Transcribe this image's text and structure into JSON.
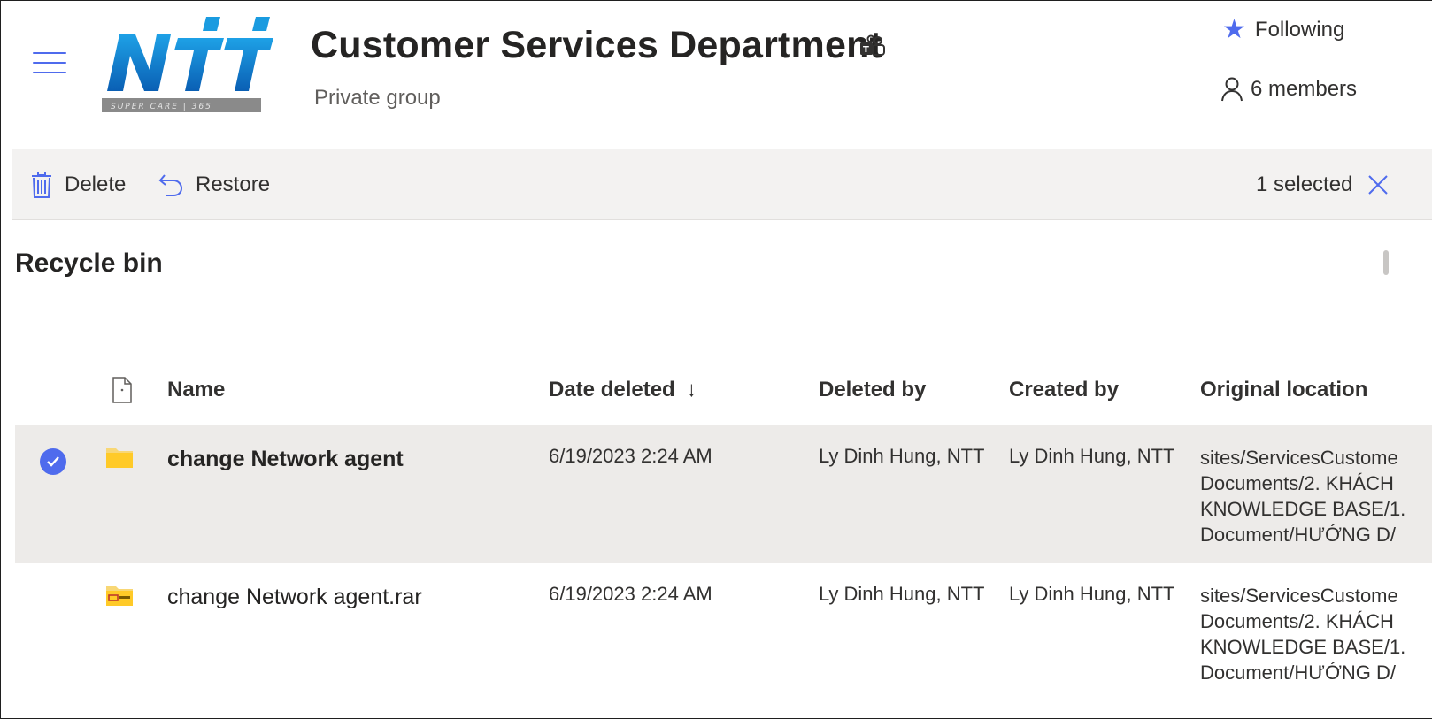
{
  "header": {
    "site_title": "Customer Services Department",
    "site_subtitle": "Private group",
    "logo_text": "NTT",
    "logo_tagline": "SUPER CARE | 365",
    "following_label": "Following",
    "members_label": "6 members",
    "accent_color": "#4f6bed"
  },
  "command_bar": {
    "delete_label": "Delete",
    "restore_label": "Restore",
    "selection_label": "1 selected"
  },
  "page": {
    "title": "Recycle bin"
  },
  "table": {
    "columns": {
      "name": "Name",
      "date_deleted": "Date deleted",
      "sort_indicator": "↓",
      "deleted_by": "Deleted by",
      "created_by": "Created by",
      "original_location": "Original location"
    },
    "rows": [
      {
        "selected": true,
        "icon": "folder-icon",
        "name": "change Network agent",
        "date_deleted": "6/19/2023 2:24 AM",
        "deleted_by": "Ly Dinh Hung, NTT",
        "created_by": "Ly Dinh Hung, NTT",
        "original_location": "sites/ServicesCustome Documents/2. KHÁCH KNOWLEDGE BASE/1. Document/HƯỚNG D/"
      },
      {
        "selected": false,
        "icon": "archive-folder-icon",
        "name": "change Network agent.rar",
        "date_deleted": "6/19/2023 2:24 AM",
        "deleted_by": "Ly Dinh Hung, NTT",
        "created_by": "Ly Dinh Hung, NTT",
        "original_location": "sites/ServicesCustome Documents/2. KHÁCH KNOWLEDGE BASE/1. Document/HƯỚNG D/"
      }
    ]
  }
}
